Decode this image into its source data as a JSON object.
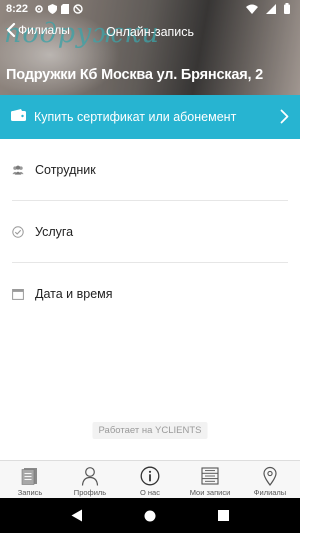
{
  "status_bar": {
    "time": "8:22",
    "icons": [
      "settings-icon",
      "shield-icon",
      "sd-card-icon",
      "blocked-icon",
      "wifi-icon",
      "signal-icon",
      "battery-icon"
    ]
  },
  "header": {
    "back_label": "Филиалы",
    "title": "Онлайн-запись",
    "branch_name": "Подружки Кб Москва ул. Брянская, 2",
    "logo_text": "подружки"
  },
  "certificate": {
    "label": "Купить сертификат или абонемент",
    "icon": "wallet-icon",
    "color": "#27b4d1"
  },
  "steps": [
    {
      "label": "Сотрудник",
      "icon": "staff-icon"
    },
    {
      "label": "Услуга",
      "icon": "check-circle-icon"
    },
    {
      "label": "Дата и время",
      "icon": "calendar-icon"
    }
  ],
  "powered_by": "Работает на YCLIENTS",
  "bottom_nav": [
    {
      "label": "Запись",
      "icon": "booking-icon"
    },
    {
      "label": "Профиль",
      "icon": "profile-icon"
    },
    {
      "label": "О нас",
      "icon": "info-icon"
    },
    {
      "label": "Мои записи",
      "icon": "list-icon"
    },
    {
      "label": "Филиалы",
      "icon": "location-icon"
    }
  ],
  "system_nav": [
    "back-icon",
    "home-icon",
    "recents-icon"
  ]
}
